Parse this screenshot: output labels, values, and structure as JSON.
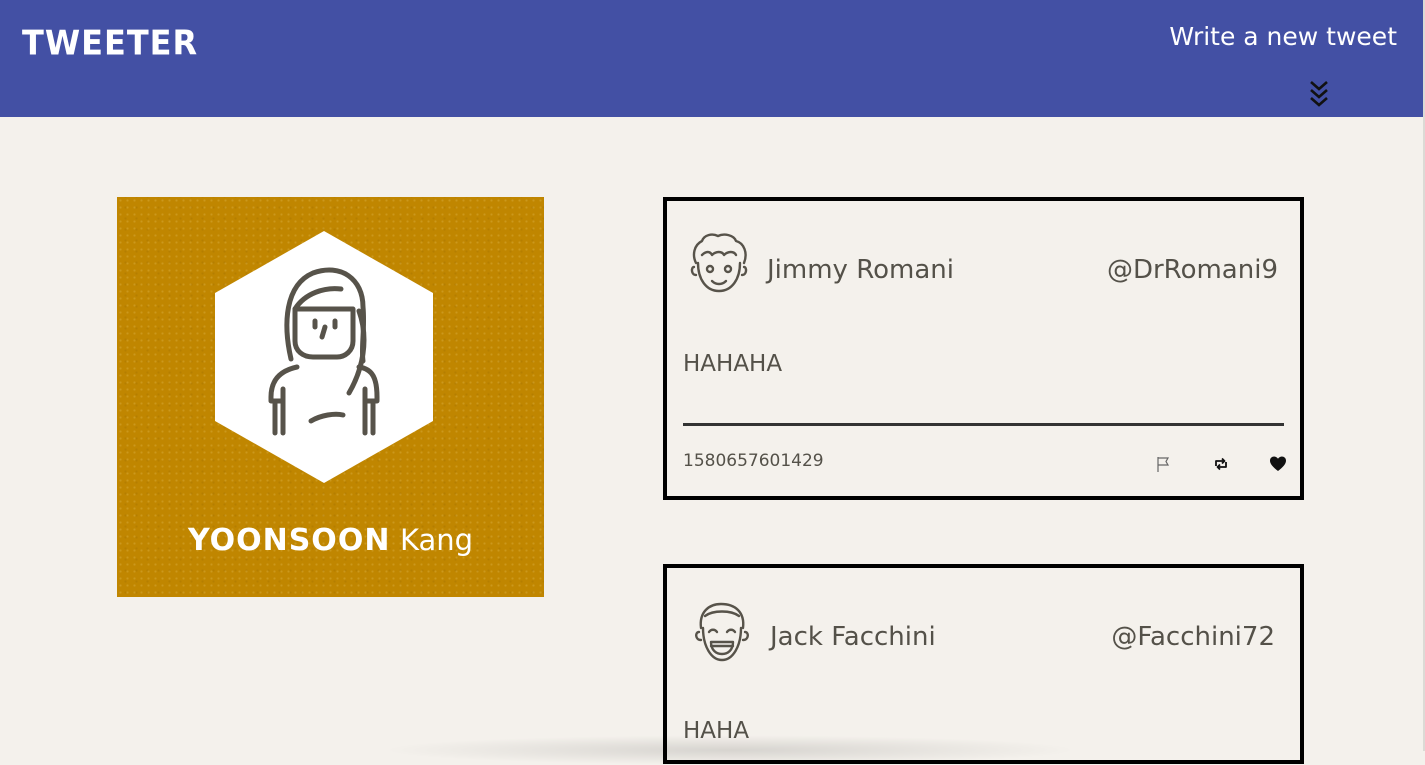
{
  "nav": {
    "brand": "TWEETER",
    "compose_label": "Write a new tweet",
    "toggle_icon": "double-chevron-down-icon",
    "background": "#4350a4"
  },
  "profile": {
    "first_name": "YOONSOON",
    "last_name": "Kang",
    "avatar_icon": "woman-avatar-icon",
    "background": "#c08600"
  },
  "tweets": [
    {
      "name": "Jimmy Romani",
      "handle": "@DrRomani9",
      "body": "HAHAHA",
      "timestamp": "1580657601429",
      "avatar_icon": "curly-hair-man-avatar-icon",
      "actions": [
        "flag-icon",
        "retweet-icon",
        "heart-icon"
      ]
    },
    {
      "name": "Jack Facchini",
      "handle": "@Facchini72",
      "body": "HAHA",
      "avatar_icon": "laughing-man-avatar-icon"
    }
  ]
}
